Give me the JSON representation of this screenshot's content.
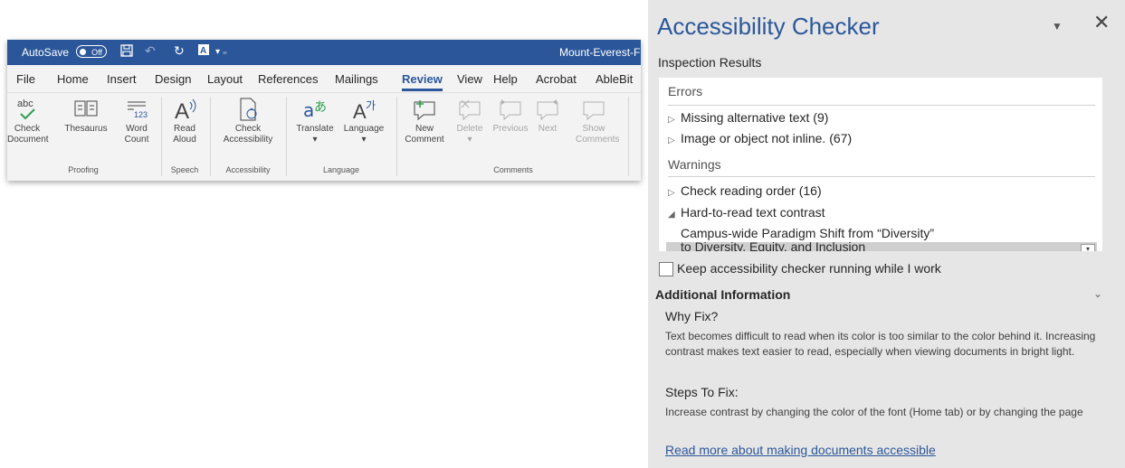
{
  "word": {
    "autosave_label": "AutoSave",
    "autosave_state": "Off",
    "doc_title": "Mount-Everest-Fi",
    "tabs": [
      "File",
      "Home",
      "Insert",
      "Design",
      "Layout",
      "References",
      "Mailings",
      "Review",
      "View",
      "Help",
      "Acrobat",
      "AbleBit"
    ],
    "active_tab": "Review",
    "ribbon": {
      "check_document": "Check Document",
      "thesaurus": "Thesaurus",
      "word_count": "Word Count",
      "read_aloud": "Read Aloud",
      "check_accessibility": "Check Accessibility",
      "translate": "Translate",
      "language": "Language",
      "new_comment": "New Comment",
      "delete": "Delete",
      "previous": "Previous",
      "next": "Next",
      "show_comments": "Show Comments",
      "groups": {
        "proofing": "Proofing",
        "speech": "Speech",
        "accessibility": "Accessibility",
        "language": "Language",
        "comments": "Comments"
      }
    }
  },
  "pane": {
    "title": "Accessibility Checker",
    "inspection_label": "Inspection Results",
    "errors_header": "Errors",
    "errors": [
      "Missing alternative text (9)",
      "Image or object not inline. (67)"
    ],
    "warnings_header": "Warnings",
    "warnings": [
      "Check reading order (16)",
      "Hard-to-read text contrast"
    ],
    "expanded_item": "Campus-wide Paradigm Shift from “Diversity”",
    "selected_item": "to Diversity, Equity, and Inclusion",
    "keep_running_label": "Keep accessibility checker running while I work",
    "additional_info": "Additional Information",
    "why_fix_title": "Why Fix?",
    "why_fix_text": "Text becomes difficult to read when its color is too similar to the color behind it. Increasing contrast makes text easier to read, especially when viewing documents in bright light.",
    "steps_title": "Steps To Fix:",
    "steps_text": "Increase contrast by changing the color of the font (Home tab) or by changing the page color (Design tab).",
    "read_more_link": "Read more about making documents accessible"
  }
}
